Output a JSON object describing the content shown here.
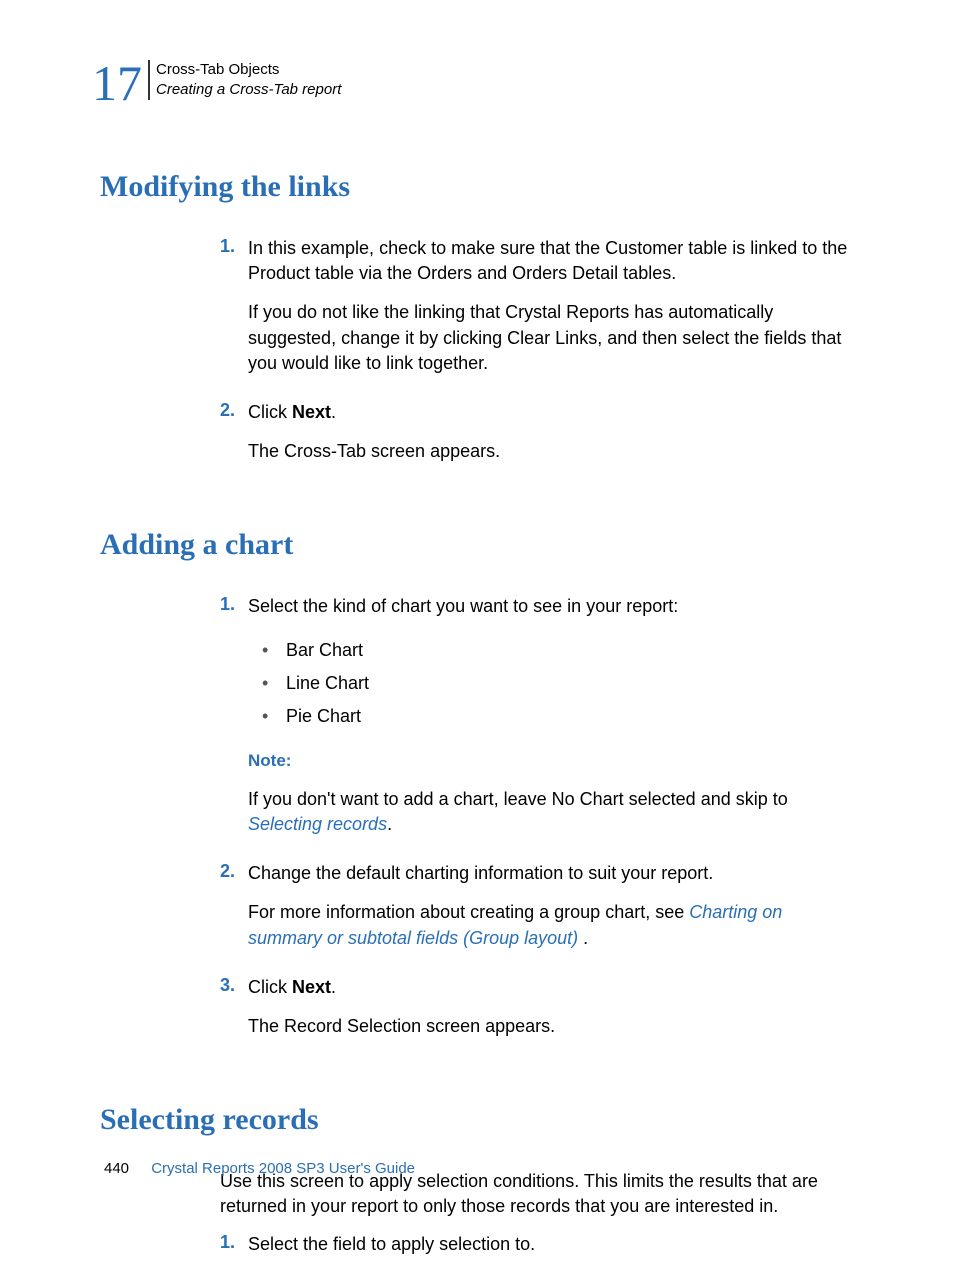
{
  "header": {
    "chapter_number": "17",
    "line1": "Cross-Tab Objects",
    "line2": "Creating a Cross-Tab report"
  },
  "sections": {
    "modifying": {
      "heading": "Modifying the links",
      "step1_num": "1.",
      "step1_p1": "In this example, check to make sure that the Customer table is linked to the Product table via the Orders and Orders Detail tables.",
      "step1_p2": "If you do not like the linking that Crystal Reports has automatically suggested, change it by clicking Clear Links, and then select the fields that you would like to link together.",
      "step2_num": "2.",
      "step2_prefix": "Click ",
      "step2_bold": "Next",
      "step2_suffix": ".",
      "step2_result": "The Cross-Tab screen appears."
    },
    "adding": {
      "heading": "Adding a chart",
      "step1_num": "1.",
      "step1_intro": "Select the kind of chart you want to see in your report:",
      "bullets": {
        "b1": "Bar Chart",
        "b2": "Line Chart",
        "b3": "Pie Chart"
      },
      "note_label": "Note:",
      "note_text_before": "If you don't want to add a chart, leave No Chart selected and skip to ",
      "note_link": "Selecting records",
      "note_text_after": ".",
      "step2_num": "2.",
      "step2_p1": "Change the default charting information to suit your report.",
      "step2_p2_before": "For more information about creating a group chart, see ",
      "step2_link": "Charting on summary or subtotal fields (Group layout)",
      "step2_p2_after": " .",
      "step3_num": "3.",
      "step3_prefix": "Click ",
      "step3_bold": "Next",
      "step3_suffix": ".",
      "step3_result": "The Record Selection screen appears."
    },
    "selecting": {
      "heading": "Selecting records",
      "intro": "Use this screen to apply selection conditions. This limits the results that are returned in your report to only those records that you are interested in.",
      "step1_num": "1.",
      "step1_text": "Select the field to apply selection to."
    }
  },
  "footer": {
    "page_number": "440",
    "doc_title": "Crystal Reports 2008 SP3 User's Guide"
  }
}
